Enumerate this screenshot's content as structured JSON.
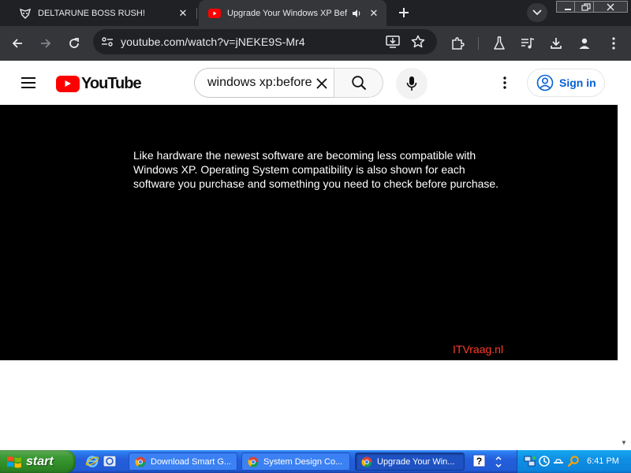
{
  "browser": {
    "tabs": [
      {
        "title": "DELTARUNE BOSS RUSH!",
        "favicon": "deltarune-icon",
        "active": false
      },
      {
        "title": "Upgrade Your Windows XP Bef",
        "favicon": "youtube-icon",
        "active": true,
        "audio": true
      }
    ],
    "address": "youtube.com/watch?v=jNEKE9S-Mr4"
  },
  "youtube": {
    "logo_text": "YouTube",
    "search_value": "windows xp:before",
    "signin_label": "Sign in"
  },
  "video": {
    "caption_lines": [
      "Like hardware the newest software are becoming less compatible with",
      "Windows XP. Operating System compatibility is also shown for each",
      "software you purchase and something you need to check before purchase."
    ],
    "watermark": "ITVraag.nl"
  },
  "taskbar": {
    "start_label": "start",
    "tasks": [
      {
        "label": "Download Smart G...",
        "active": false
      },
      {
        "label": "System Design Co...",
        "active": false
      },
      {
        "label": "Upgrade Your Win...",
        "active": true
      }
    ],
    "clock": "6:41 PM"
  },
  "colors": {
    "chrome_dark": "#202124",
    "chrome_toolbar": "#35363a",
    "youtube_red": "#ff0000",
    "signin_blue": "#065fd4",
    "watermark_red": "#ff3a2a",
    "xp_taskbar_blue": "#245edb",
    "xp_start_green": "#3c9a34",
    "xp_tray_blue": "#0f8fe4"
  }
}
